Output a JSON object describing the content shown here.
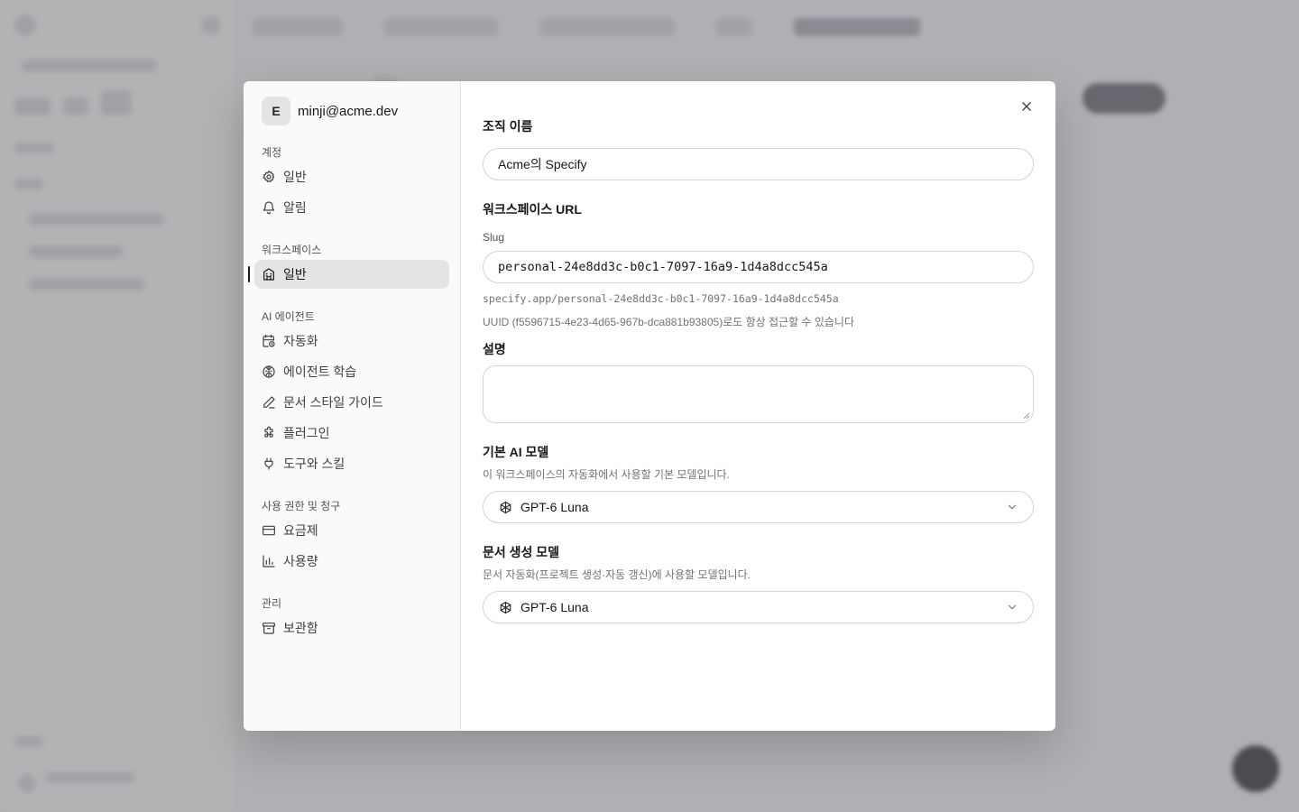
{
  "account": {
    "initial": "E",
    "email": "minji@acme.dev"
  },
  "nav": {
    "account_section": "계정",
    "account_items": [
      {
        "label": "일반",
        "icon": "gear-icon"
      },
      {
        "label": "알림",
        "icon": "bell-icon"
      }
    ],
    "workspace_section": "워크스페이스",
    "workspace_items": [
      {
        "label": "일반",
        "icon": "building-icon",
        "active": true
      }
    ],
    "agent_section": "AI 에이전트",
    "agent_items": [
      {
        "label": "자동화",
        "icon": "calendar-clock-icon"
      },
      {
        "label": "에이전트 학습",
        "icon": "brain-icon"
      },
      {
        "label": "문서 스타일 가이드",
        "icon": "pen-icon"
      },
      {
        "label": "플러그인",
        "icon": "puzzle-icon"
      },
      {
        "label": "도구와 스킬",
        "icon": "plug-icon"
      }
    ],
    "billing_section": "사용 권한 및 청구",
    "billing_items": [
      {
        "label": "요금제",
        "icon": "credit-card-icon"
      },
      {
        "label": "사용량",
        "icon": "bar-chart-icon"
      }
    ],
    "admin_section": "관리",
    "admin_items": [
      {
        "label": "보관함",
        "icon": "archive-icon"
      }
    ]
  },
  "form": {
    "org_name_label": "조직 이름",
    "org_name_value": "Acme의 Specify",
    "workspace_url_label": "워크스페이스 URL",
    "slug_label": "Slug",
    "slug_value": "personal-24e8dd3c-b0c1-7097-16a9-1d4a8dcc545a",
    "slug_preview": "specify.app/personal-24e8dd3c-b0c1-7097-16a9-1d4a8dcc545a",
    "uuid_hint": "UUID (f5596715-4e23-4d65-967b-dca881b93805)로도 항상 접근할 수 있습니다",
    "description_label": "설명",
    "description_value": "",
    "default_model_label": "기본 AI 모델",
    "default_model_hint": "이 워크스페이스의 자동화에서 사용할 기본 모델입니다.",
    "default_model_value": "GPT-6 Luna",
    "doc_model_label": "문서 생성 모델",
    "doc_model_hint": "문서 자동화(프로젝트 생성·자동 갱신)에 사용할 모델입니다.",
    "doc_model_value": "GPT-6 Luna"
  }
}
